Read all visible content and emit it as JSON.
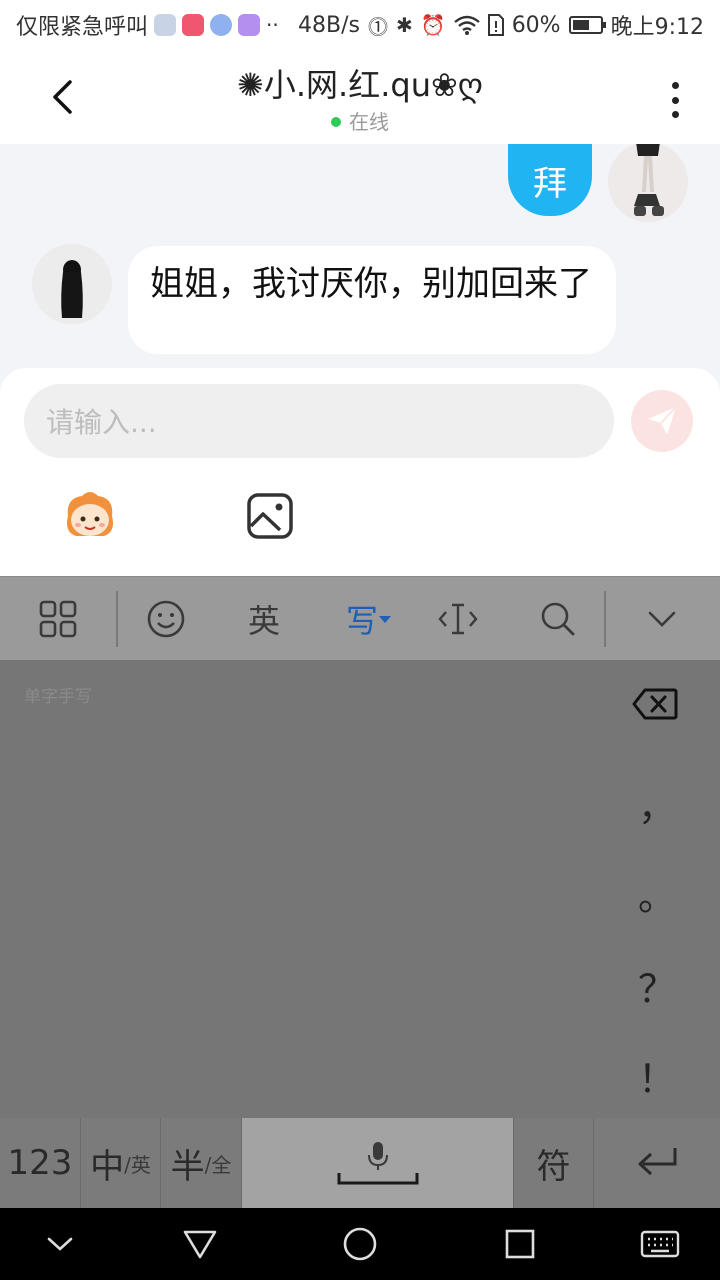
{
  "status_bar": {
    "carrier": "仅限紧急呼叫",
    "speed": "48B/s",
    "battery": "60%",
    "battery_level": 0.6,
    "time": "晚上9:12",
    "dots": "··"
  },
  "header": {
    "title": "✺小.网.红.qu❀ღ",
    "status": "在线"
  },
  "messages": [
    {
      "side": "right",
      "text": "拜"
    },
    {
      "side": "left",
      "text": "姐姐，我讨厌你，别加回来了"
    }
  ],
  "input": {
    "placeholder": "请输入..."
  },
  "keyboard": {
    "toolbar": {
      "english": "英",
      "write": "写"
    },
    "hint": "单字手写",
    "punctuation": [
      "，",
      "。",
      "？",
      "！"
    ],
    "keys": {
      "num": "123",
      "zh": "中",
      "zh_alt": "/英",
      "half": "半",
      "half_alt": "/全",
      "symbol": "符"
    }
  },
  "colors": {
    "accent_blue": "#21b4f2",
    "online_green": "#2ecc57",
    "keyboard_active": "#1f5fb4"
  }
}
